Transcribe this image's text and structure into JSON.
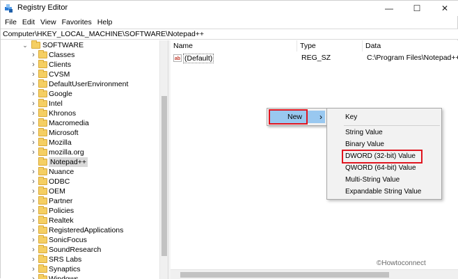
{
  "window": {
    "title": "Registry Editor",
    "minimize_glyph": "—",
    "maximize_glyph": "☐",
    "close_glyph": "✕"
  },
  "menu": [
    "File",
    "Edit",
    "View",
    "Favorites",
    "Help"
  ],
  "address": "Computer\\HKEY_LOCAL_MACHINE\\SOFTWARE\\Notepad++",
  "tree": {
    "root": "SOFTWARE",
    "items": [
      "Classes",
      "Clients",
      "CVSM",
      "DefaultUserEnvironment",
      "Google",
      "Intel",
      "Khronos",
      "Macromedia",
      "Microsoft",
      "Mozilla",
      "mozilla.org",
      "Notepad++",
      "Nuance",
      "ODBC",
      "OEM",
      "Partner",
      "Policies",
      "Realtek",
      "RegisteredApplications",
      "SonicFocus",
      "SoundResearch",
      "SRS Labs",
      "Synaptics",
      "Windows"
    ],
    "selected": "Notepad++"
  },
  "columns": {
    "name": "Name",
    "type": "Type",
    "data": "Data"
  },
  "values": [
    {
      "name": "(Default)",
      "type": "REG_SZ",
      "data": "C:\\Program Files\\Notepad++"
    }
  ],
  "context_menu": {
    "new_label": "New",
    "arrow": "›",
    "submenu": [
      "Key",
      "String Value",
      "Binary Value",
      "DWORD (32-bit) Value",
      "QWORD (64-bit) Value",
      "Multi-String Value",
      "Expandable String Value"
    ]
  },
  "watermark": "©Howtoconnect",
  "colors": {
    "highlight": "#99c8f0",
    "annotation_red": "#e0141e",
    "folder": "#f5cf63"
  }
}
